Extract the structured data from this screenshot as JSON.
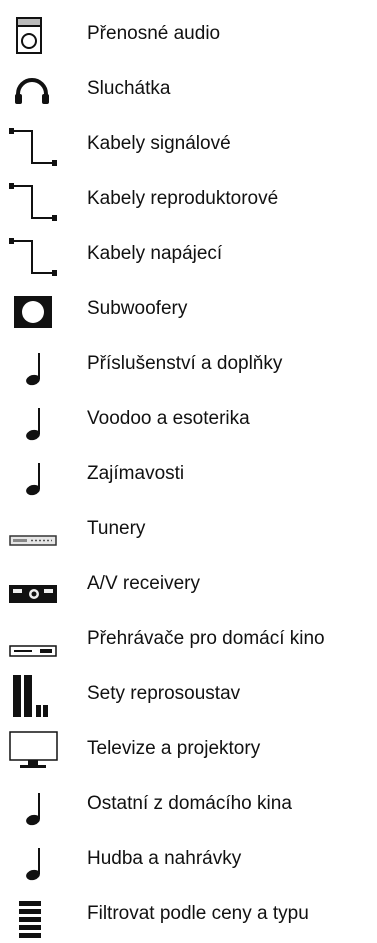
{
  "menu": {
    "items": [
      {
        "label": "Přenosné audio",
        "icon": "portable-speaker-icon"
      },
      {
        "label": "Sluchátka",
        "icon": "headphones-icon"
      },
      {
        "label": "Kabely signálové",
        "icon": "cable-icon"
      },
      {
        "label": "Kabely reproduktorové",
        "icon": "cable-icon"
      },
      {
        "label": "Kabely napájecí",
        "icon": "cable-icon"
      },
      {
        "label": "Subwoofery",
        "icon": "subwoofer-icon"
      },
      {
        "label": "Příslušenství a doplňky",
        "icon": "music-note-icon"
      },
      {
        "label": "Voodoo a esoterika",
        "icon": "music-note-icon"
      },
      {
        "label": "Zajímavosti",
        "icon": "music-note-icon"
      },
      {
        "label": "Tunery",
        "icon": "tuner-icon"
      },
      {
        "label": "A/V receivery",
        "icon": "av-receiver-icon"
      },
      {
        "label": "Přehrávače pro domácí kino",
        "icon": "disc-player-icon"
      },
      {
        "label": "Sety reprosoustav",
        "icon": "speaker-set-icon"
      },
      {
        "label": "Televize a projektory",
        "icon": "tv-icon"
      },
      {
        "label": "Ostatní z domácího kina",
        "icon": "music-note-icon"
      },
      {
        "label": "Hudba a nahrávky",
        "icon": "music-note-icon"
      },
      {
        "label": "Filtrovat podle ceny a typu",
        "icon": "filter-list-icon"
      }
    ]
  }
}
